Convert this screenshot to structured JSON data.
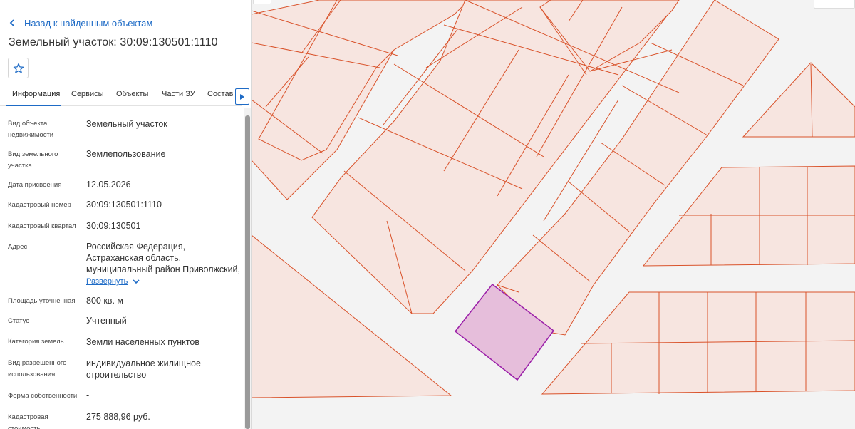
{
  "panel": {
    "back_label": "Назад к найденным объектам",
    "title": "Земельный участок: 30:09:130501:1110",
    "tabs": [
      "Информация",
      "Сервисы",
      "Объекты",
      "Части ЗУ",
      "Состав"
    ],
    "fields": [
      {
        "label": "Вид объекта недвижимости",
        "value": "Земельный участок"
      },
      {
        "label": "Вид земельного участка",
        "value": "Землепользование"
      },
      {
        "label": "Дата присвоения",
        "value": "12.05.2026"
      },
      {
        "label": "Кадастровый номер",
        "value": "30:09:130501:1110"
      },
      {
        "label": "Кадастровый квартал",
        "value": "30:09:130501"
      },
      {
        "label": "Адрес",
        "value": "Российская Федерация, Астраханская область, муниципальный район Приволжский,",
        "expand_label": "Развернуть"
      },
      {
        "label": "Площадь уточненная",
        "value": "800 кв. м"
      },
      {
        "label": "Статус",
        "value": "Учтенный"
      },
      {
        "label": "Категория земель",
        "value": "Земли населенных пунктов"
      },
      {
        "label": "Вид разрешенного использования",
        "value": "индивидуальное жилищное строительство"
      },
      {
        "label": "Форма собственности",
        "value": "-"
      },
      {
        "label": "Кадастровая стоимость",
        "value": "275 888,96 руб."
      }
    ]
  },
  "colors": {
    "accent": "#1e6bc6",
    "parcel_fill": "#f7e5e0",
    "parcel_stroke": "#d9522a",
    "selected_fill": "#e6bedb",
    "selected_stroke": "#9b1fa8"
  },
  "icons": {
    "back": "chevron-left-icon",
    "favorite": "star-outline-icon",
    "tabs_next": "triangle-right-icon",
    "expand": "chevron-down-icon"
  }
}
